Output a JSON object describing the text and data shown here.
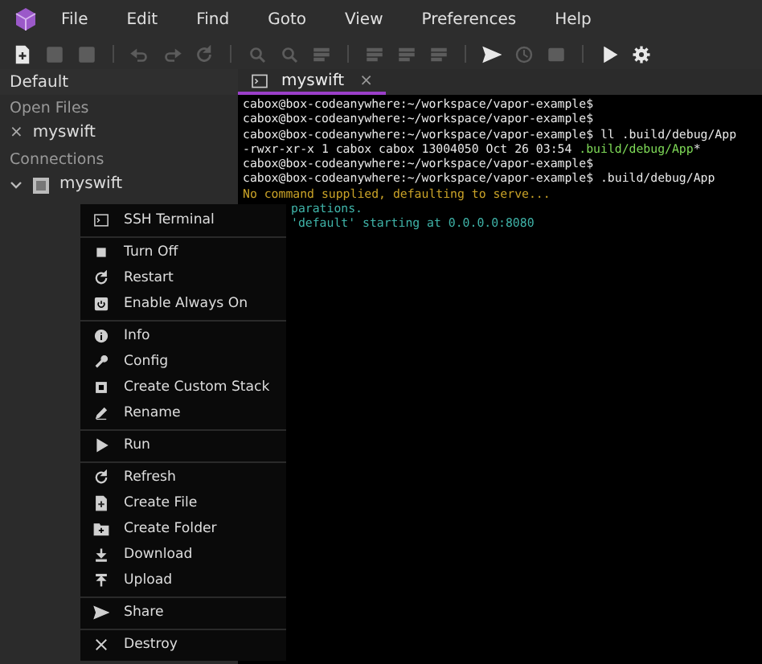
{
  "menubar": {
    "items": [
      "File",
      "Edit",
      "Find",
      "Goto",
      "View",
      "Preferences",
      "Help"
    ]
  },
  "toolbar": {
    "groups": [
      [
        {
          "disabled": false
        },
        {
          "disabled": true
        },
        {
          "disabled": true
        }
      ],
      [
        {
          "disabled": true
        },
        {
          "disabled": true
        },
        {
          "disabled": true
        }
      ],
      [
        {
          "disabled": true
        },
        {
          "disabled": true
        },
        {
          "disabled": true
        }
      ],
      [
        {
          "disabled": true
        },
        {
          "disabled": true
        },
        {
          "disabled": true
        }
      ],
      [
        {
          "disabled": false
        },
        {
          "disabled": true
        },
        {
          "disabled": true
        }
      ],
      [
        {
          "disabled": false
        },
        {
          "disabled": false
        }
      ]
    ]
  },
  "sidebar": {
    "title": "Default",
    "sections": [
      {
        "title": "Open Files",
        "items": [
          {
            "close": "×",
            "label": "myswift"
          }
        ]
      },
      {
        "title": "Connections",
        "items": [
          {
            "expanded": true,
            "label": "myswift"
          }
        ]
      }
    ]
  },
  "tabs": [
    {
      "label": "myswift",
      "close": "×",
      "selected": true
    }
  ],
  "terminal": {
    "lines": [
      {
        "kind": "plain",
        "text": "cabox@box-codeanywhere:~/workspace/vapor-example$"
      },
      {
        "kind": "plain",
        "text": "cabox@box-codeanywhere:~/workspace/vapor-example$"
      },
      {
        "kind": "plain",
        "text": "cabox@box-codeanywhere:~/workspace/vapor-example$ ll .build/debug/App"
      },
      {
        "kind": "listing",
        "text": "-rwxr-xr-x 1 cabox cabox 13004050 Oct 26 03:54 ",
        "highlight": ".build/debug/App",
        "suffix": "*"
      },
      {
        "kind": "plain",
        "text": "cabox@box-codeanywhere:~/workspace/vapor-example$"
      },
      {
        "kind": "plain",
        "text": "cabox@box-codeanywhere:~/workspace/vapor-example$ .build/debug/App"
      },
      {
        "kind": "warning",
        "text": "No command supplied, defaulting to serve..."
      },
      {
        "kind": "info",
        "text": "parations."
      },
      {
        "kind": "info",
        "text": "'default' starting at 0.0.0.0:8080"
      }
    ]
  },
  "context_menu": {
    "groups": [
      [
        "SSH Terminal"
      ],
      [
        "Turn Off",
        "Restart",
        "Enable Always On"
      ],
      [
        "Info",
        "Config",
        "Create Custom Stack",
        "Rename"
      ],
      [
        "Run"
      ],
      [
        "Refresh",
        "Create File",
        "Create Folder",
        "Download",
        "Upload"
      ],
      [
        "Share"
      ],
      [
        "Destroy"
      ]
    ]
  }
}
